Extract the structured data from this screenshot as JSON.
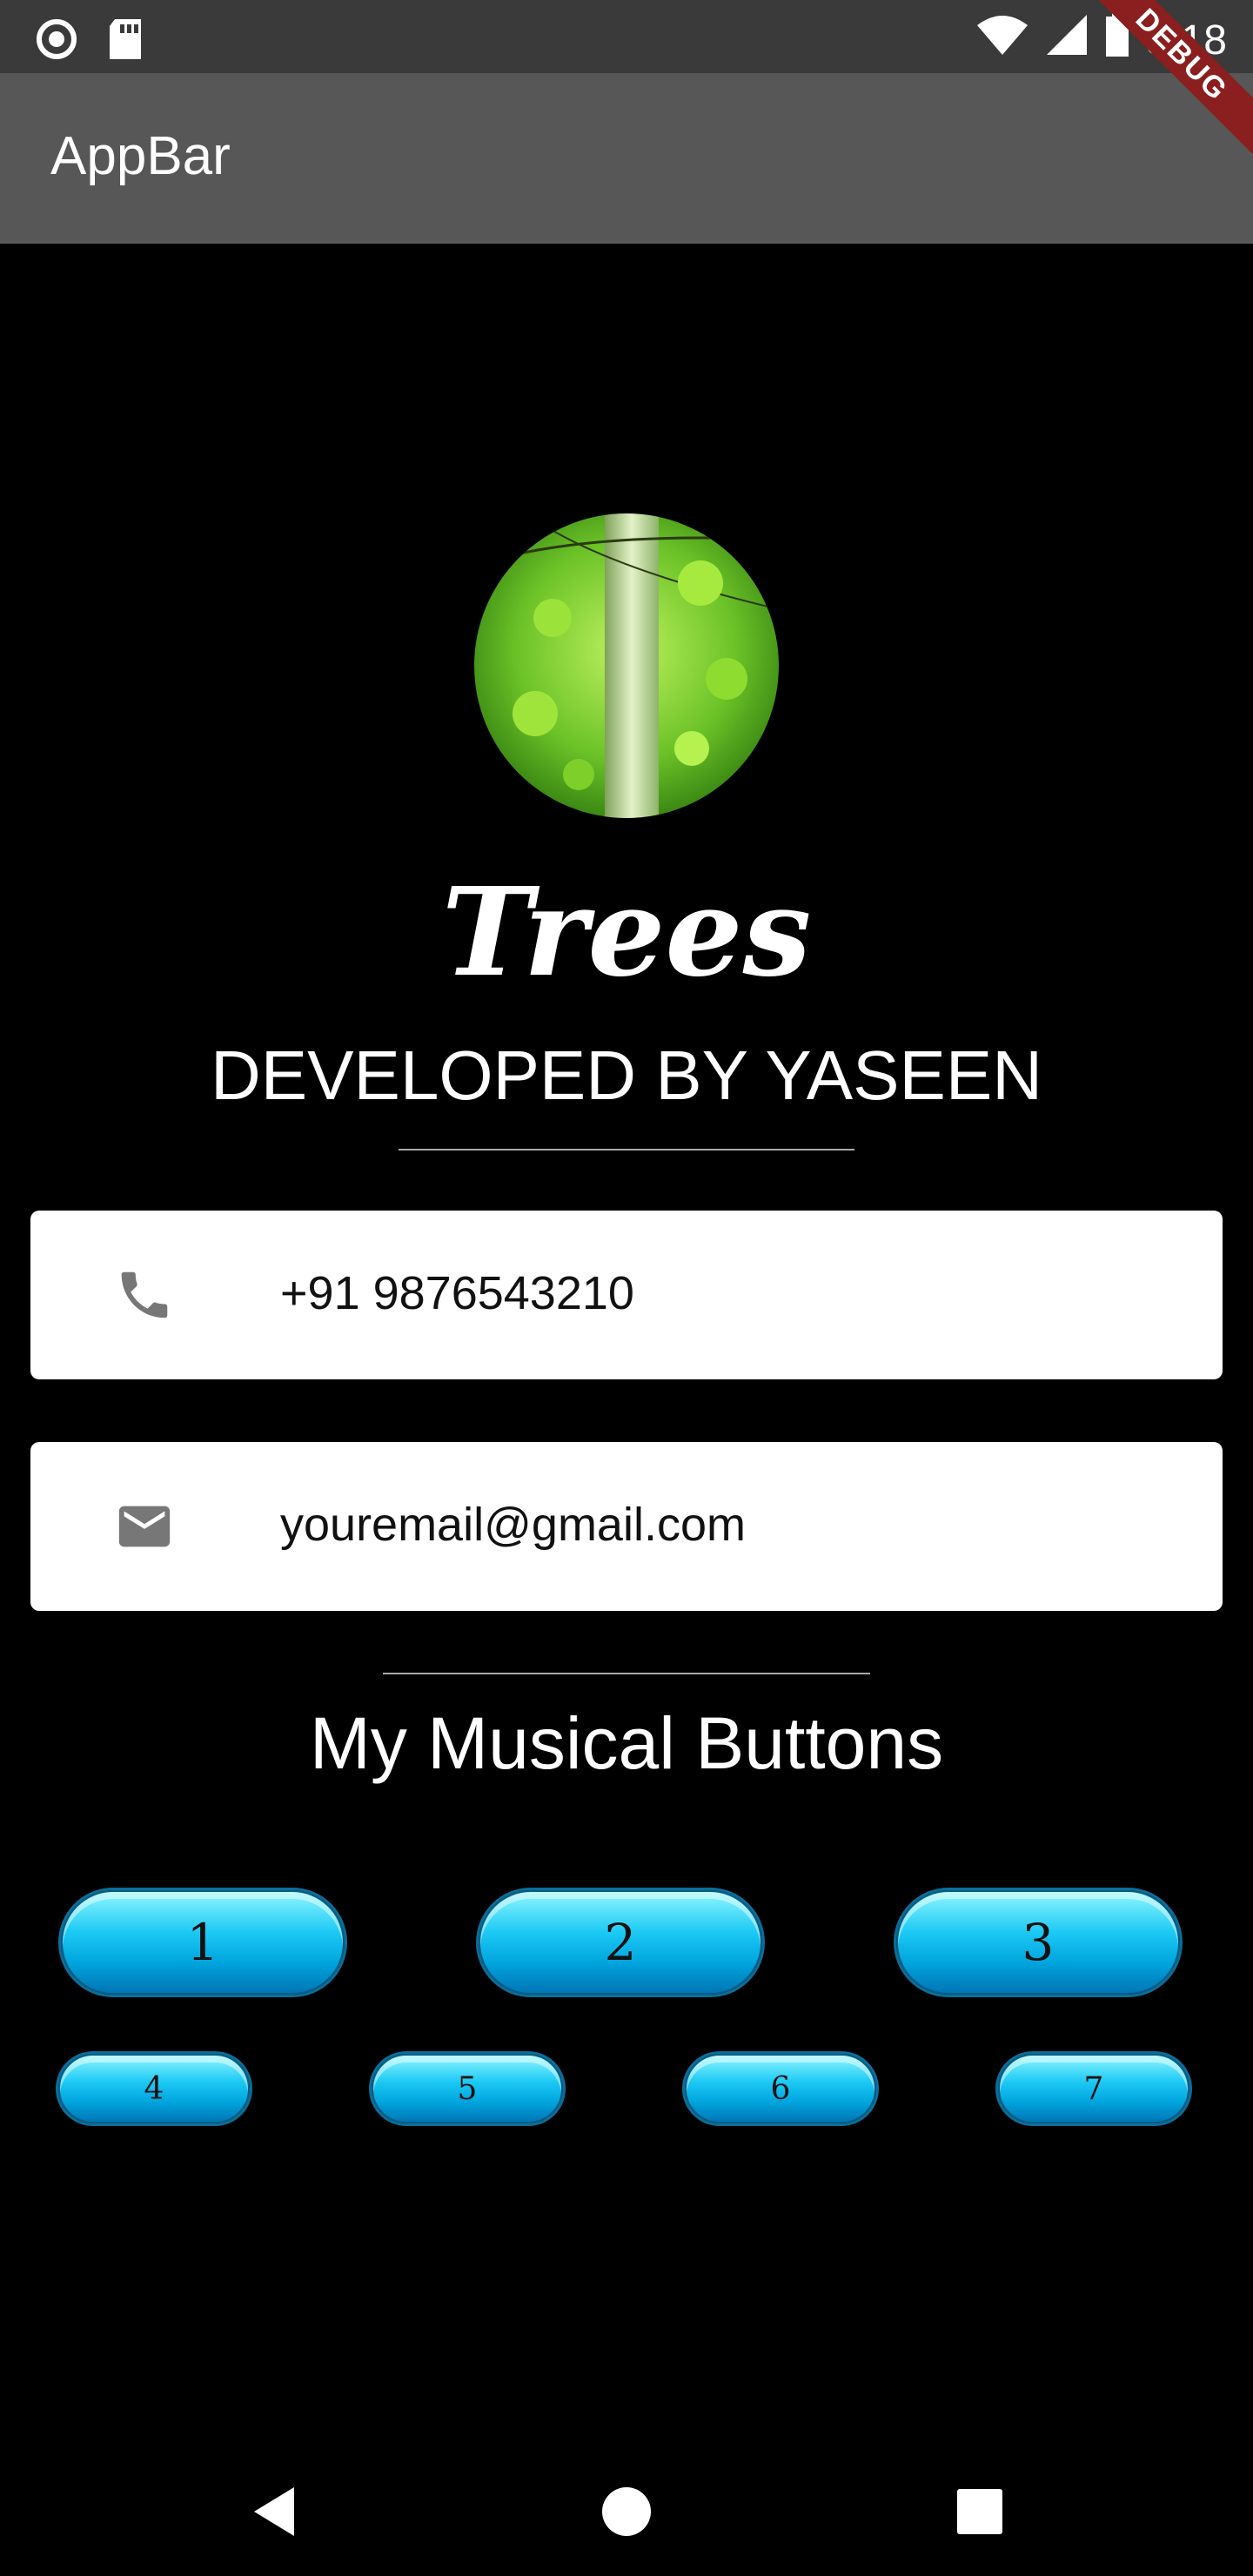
{
  "status_bar": {
    "time": "8:18",
    "icons": [
      "record-icon",
      "sd-card-icon",
      "wifi-icon",
      "signal-icon",
      "battery-icon"
    ]
  },
  "appbar": {
    "title": "AppBar",
    "debug_label": "DEBUG"
  },
  "profile": {
    "name": "Trees",
    "subtitle": "DEVELOPED BY YASEEN"
  },
  "contacts": {
    "phone": {
      "icon": "phone-icon",
      "text": "+91 9876543210"
    },
    "email": {
      "icon": "mail-icon",
      "text": "youremail@gmail.com"
    }
  },
  "section": {
    "title": "My Musical Buttons"
  },
  "musical_buttons": {
    "row1": [
      "1",
      "2",
      "3"
    ],
    "row2": [
      "4",
      "5",
      "6",
      "7"
    ]
  },
  "nav": [
    "back-icon",
    "home-icon",
    "recents-icon"
  ],
  "colors": {
    "appbar": "#575757",
    "statusbar": "#3a3a3a",
    "button_accent": "#1cc9f4",
    "ribbon": "#8b1e1e"
  }
}
